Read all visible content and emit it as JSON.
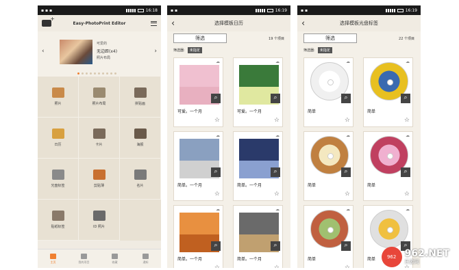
{
  "status": {
    "time": "16:18",
    "time2": "16:19",
    "time3": "16:19"
  },
  "home": {
    "title": "Easy-PhotoPrint Editor",
    "banner_line1": "可爱的",
    "banner_title": "无边距(x4)",
    "banner_line3": "照片布局",
    "grid": [
      {
        "label": "照片",
        "color": "#c98a4a"
      },
      {
        "label": "照片布局",
        "color": "#9a8a70"
      },
      {
        "label": "拼贴画",
        "color": "#7a6a5a"
      },
      {
        "label": "日历",
        "color": "#d8a040"
      },
      {
        "label": "卡片",
        "color": "#7a6a5a"
      },
      {
        "label": "海报",
        "color": "#6a5a4a"
      },
      {
        "label": "光盘标签",
        "color": "#8a8a8a"
      },
      {
        "label": "剪贴薄",
        "color": "#c87030"
      },
      {
        "label": "名片",
        "color": "#7a7a7a"
      },
      {
        "label": "贴纸标签",
        "color": "#8a7a6a"
      },
      {
        "label": "ID 照片",
        "color": "#6a6a6a"
      }
    ],
    "tabs": [
      "主页",
      "我的项目",
      "收藏",
      "通知"
    ]
  },
  "cal": {
    "title": "选择模板日历",
    "filter_btn": "筛选",
    "count": "19 个项目",
    "filter_label": "筛选器:",
    "filter_tag": "未指定",
    "tiles": [
      {
        "name": "可爱。一个月",
        "c1": "#f0c0d0",
        "c2": "#e8b0c0"
      },
      {
        "name": "可爱。一个月",
        "c1": "#3a7a3a",
        "c2": "#e0e8a0"
      },
      {
        "name": "简单。一个月",
        "c1": "#8aa0c0",
        "c2": "#d0d0d0"
      },
      {
        "name": "简单。一个月",
        "c1": "#2a3a6a",
        "c2": "#8aa0d0"
      },
      {
        "name": "简单。一个月",
        "c1": "#e89040",
        "c2": "#c06020"
      },
      {
        "name": "简单。一个月",
        "c1": "#6a6a6a",
        "c2": "#c0a070"
      }
    ]
  },
  "disc": {
    "title": "选择模板光盘标签",
    "filter_btn": "筛选",
    "count": "22 个项目",
    "filter_label": "筛选器:",
    "filter_tag": "未指定",
    "tiles": [
      {
        "name": "简单",
        "c1": "#ffffff",
        "c2": "#f0f0f0"
      },
      {
        "name": "简单",
        "c1": "#3a6ab0",
        "c2": "#e8c020"
      },
      {
        "name": "简单",
        "c1": "#f4e8c0",
        "c2": "#c08040"
      },
      {
        "name": "简单",
        "c1": "#f0b0d0",
        "c2": "#c04060"
      },
      {
        "name": "简单",
        "c1": "#a0c070",
        "c2": "#c06040"
      },
      {
        "name": "简单",
        "c1": "#f0c040",
        "c2": "#e0e0e0"
      }
    ]
  },
  "watermark": {
    "brand": "962.NET",
    "sub": "乐游网"
  }
}
